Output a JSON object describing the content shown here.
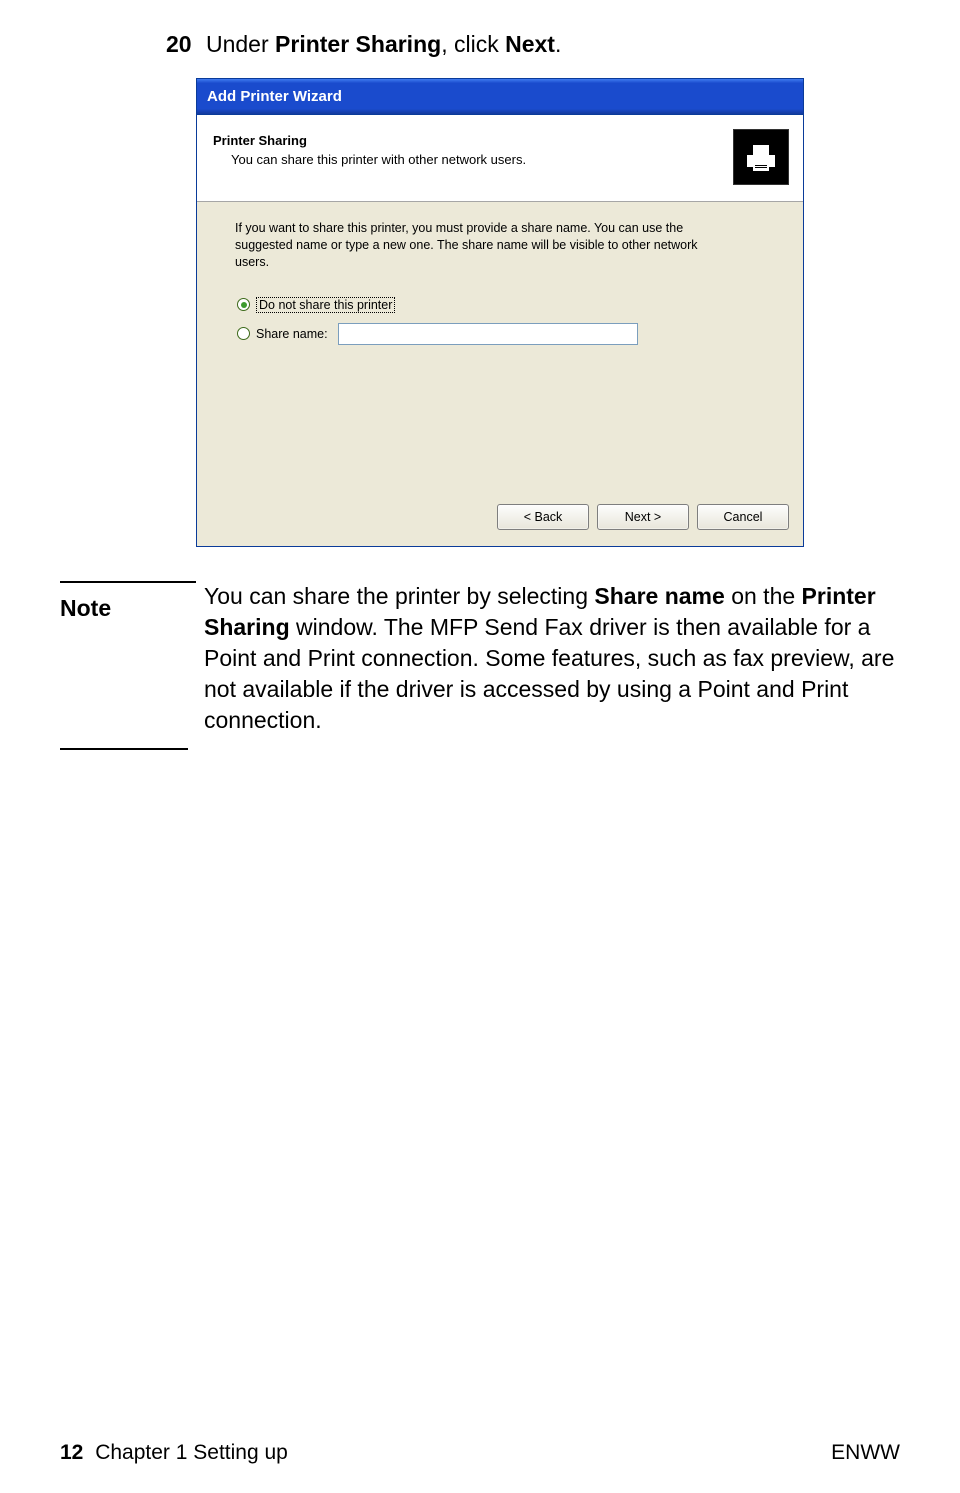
{
  "step": {
    "num": "20",
    "pre": "Under ",
    "b1": "Printer Sharing",
    "mid": ", click ",
    "b2": "Next",
    "post": "."
  },
  "dialog": {
    "title": "Add Printer Wizard",
    "header_title": "Printer Sharing",
    "header_sub": "You can share this printer with other network users.",
    "desc": "If you want to share this printer, you must provide a share name. You can use the suggested name or type a new one. The share name will be visible to other network users.",
    "radio1": "Do not share this printer",
    "radio2": "Share name:",
    "share_value": "",
    "btn_back": "< Back",
    "btn_next": "Next >",
    "btn_cancel": "Cancel"
  },
  "note": {
    "label": "Note",
    "t1": "You can share the printer by selecting ",
    "b1": "Share name",
    "t2": " on the ",
    "b2": "Printer Sharing",
    "t3": " window. The MFP Send Fax driver is then available for a Point and Print connection. Some features, such as fax preview, are not available if the driver is accessed by using a Point and Print connection."
  },
  "footer": {
    "page_num": "12",
    "chapter": "Chapter 1 Setting up",
    "right": "ENWW"
  }
}
